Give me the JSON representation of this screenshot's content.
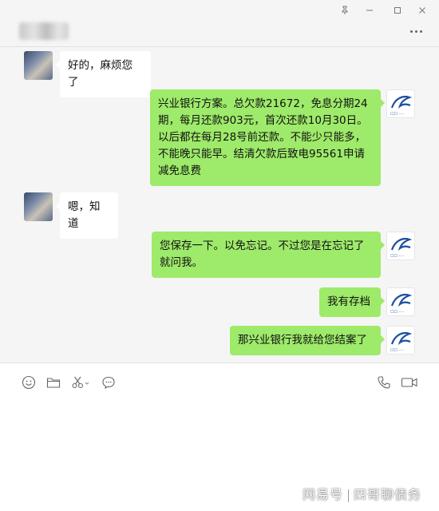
{
  "window": {
    "pin_icon": "pin-icon",
    "minimize_icon": "minimize-icon",
    "maximize_icon": "maximize-icon",
    "close_icon": "close-icon",
    "more_icon": "more-icon"
  },
  "messages": [
    {
      "side": "left",
      "text": "好的，麻烦您了"
    },
    {
      "side": "right",
      "text": "兴业银行方案。总欠款21672，免息分期24期，每月还款903元，首次还款10月30日。以后都在每月28号前还款。不能少只能多，不能晚只能早。结清欠款后致电95561申请减免息费"
    },
    {
      "side": "left",
      "text": "嗯，知道"
    },
    {
      "side": "right",
      "text": "您保存一下。以免忘记。不过您是在忘记了就问我。"
    },
    {
      "side": "right",
      "text": "我有存档"
    },
    {
      "side": "right",
      "text": "那兴业银行我就给您结案了"
    }
  ],
  "toolbar": {
    "emoji_icon": "emoji-icon",
    "folder_icon": "folder-icon",
    "scissors_icon": "scissors-icon",
    "chat_icon": "chat-bubble-icon",
    "phone_icon": "phone-icon",
    "video_icon": "video-icon"
  },
  "watermark": {
    "left": "网易号",
    "right": "四哥聊债务"
  },
  "colors": {
    "sent_bubble": "#9eea6a",
    "received_bubble": "#ffffff",
    "chat_background": "#f5f5f5"
  }
}
